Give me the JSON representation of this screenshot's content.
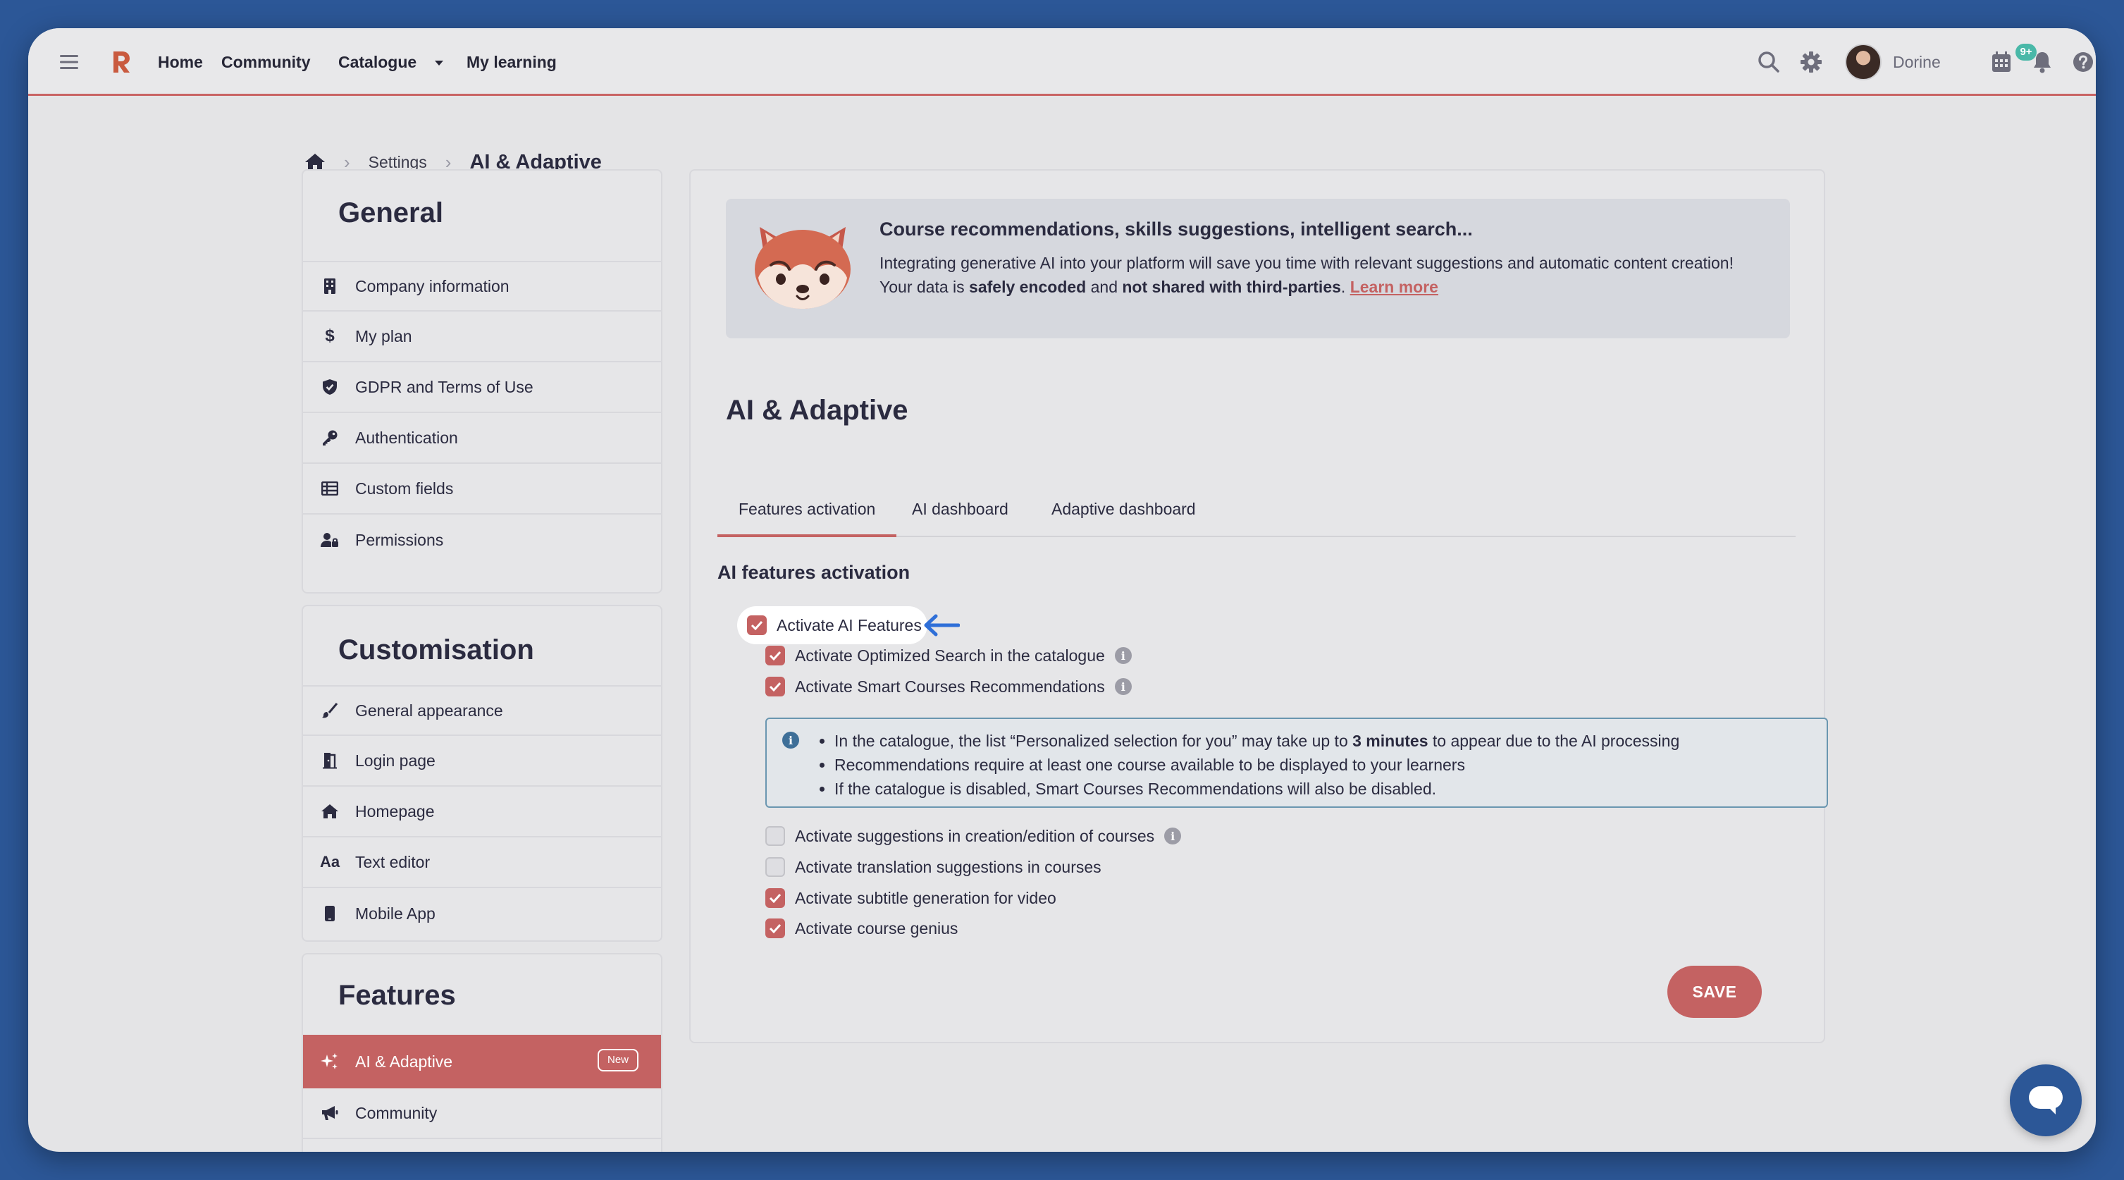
{
  "topbar": {
    "nav": [
      {
        "label": "Home"
      },
      {
        "label": "Community"
      },
      {
        "label": "Catalogue"
      },
      {
        "label": "My learning"
      }
    ],
    "user_name": "Dorine",
    "notification_badge": "9+"
  },
  "breadcrumb": {
    "settings": "Settings",
    "current": "AI & Adaptive"
  },
  "sidebar": {
    "general": {
      "title": "General",
      "items": [
        {
          "label": "Company information",
          "icon": "building-icon"
        },
        {
          "label": "My plan",
          "icon": "dollar-icon"
        },
        {
          "label": "GDPR and Terms of Use",
          "icon": "shield-check-icon"
        },
        {
          "label": "Authentication",
          "icon": "key-icon"
        },
        {
          "label": "Custom fields",
          "icon": "table-icon"
        },
        {
          "label": "Permissions",
          "icon": "user-lock-icon"
        }
      ]
    },
    "customisation": {
      "title": "Customisation",
      "items": [
        {
          "label": "General appearance",
          "icon": "brush-icon"
        },
        {
          "label": "Login page",
          "icon": "door-icon"
        },
        {
          "label": "Homepage",
          "icon": "home-icon"
        },
        {
          "label": "Text editor",
          "icon": "font-icon"
        },
        {
          "label": "Mobile App",
          "icon": "mobile-icon"
        }
      ]
    },
    "features": {
      "title": "Features",
      "items": [
        {
          "label": "AI & Adaptive",
          "icon": "sparkles-icon",
          "badge": "New",
          "active": true
        },
        {
          "label": "Community",
          "icon": "megaphone-icon"
        }
      ]
    }
  },
  "banner": {
    "title": "Course recommendations, skills suggestions, intelligent search...",
    "text1": "Integrating generative AI into your platform will save you time with relevant suggestions and automatic content creation!",
    "text2_a": "Your data is ",
    "text2_b": "safely encoded",
    "text2_c": " and ",
    "text2_d": "not shared with third-parties",
    "text2_e": ". ",
    "learn_more": "Learn more"
  },
  "main": {
    "title": "AI & Adaptive",
    "tabs": [
      {
        "label": "Features activation",
        "active": true
      },
      {
        "label": "AI dashboard"
      },
      {
        "label": "Adaptive dashboard"
      }
    ],
    "section_title": "AI features activation",
    "master_checkbox": {
      "label": "Activate AI Features",
      "checked": true
    },
    "options_a": [
      {
        "label": "Activate Optimized Search in the catalogue",
        "checked": true,
        "info": true
      },
      {
        "label": "Activate Smart Courses Recommendations",
        "checked": true,
        "info": true
      }
    ],
    "notice": {
      "line1_a": "In the catalogue, the list “Personalized selection for you” may take up to ",
      "line1_b": "3 minutes",
      "line1_c": " to appear due to the AI processing",
      "line2": "Recommendations require at least one course available to be displayed to your learners",
      "line3": "If the catalogue is disabled, Smart Courses Recommendations will also be disabled."
    },
    "options_b": [
      {
        "label": "Activate suggestions in creation/edition of courses",
        "checked": false,
        "info": true
      },
      {
        "label": "Activate translation suggestions in courses",
        "checked": false
      },
      {
        "label": "Activate subtitle generation for video",
        "checked": true
      },
      {
        "label": "Activate course genius",
        "checked": true
      }
    ],
    "save_label": "SAVE"
  },
  "colors": {
    "accent": "#c46262",
    "background": "#2c5797",
    "window": "#e4e4e6",
    "info_border": "#6a96b0"
  }
}
